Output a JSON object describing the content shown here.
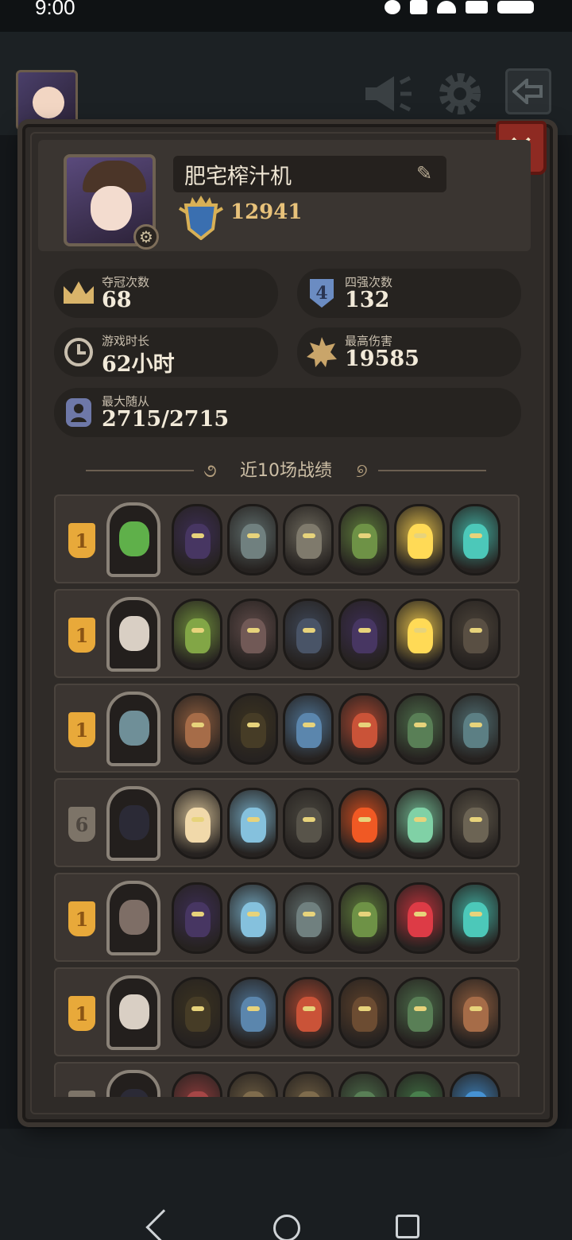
{
  "status_bar": {
    "time": "9:00"
  },
  "profile": {
    "name": "肥宅榨汁机",
    "score": "12941"
  },
  "stats": {
    "champions": {
      "label": "夺冠次数",
      "value": "68"
    },
    "top4": {
      "label": "四强次数",
      "value": "132"
    },
    "playtime": {
      "label": "游戏时长",
      "value": "62小时"
    },
    "max_damage": {
      "label": "最高伤害",
      "value": "19585"
    },
    "max_followers": {
      "label": "最大随从",
      "value": "2715/2715"
    }
  },
  "top4_icon_text": "4",
  "close_glyph": "✕",
  "section": {
    "title": "近10场战绩"
  },
  "matches": [
    {
      "place": "1",
      "hero_color": "#5fb04a",
      "units": [
        "#3b2d52",
        "#5d6b6a",
        "#6a665a",
        "#5c7a3a",
        "#d8b648",
        "#3fa79a"
      ]
    },
    {
      "place": "1",
      "hero_color": "#d9cfc4",
      "units": [
        "#6c8a3a",
        "#5e4a48",
        "#3d4656",
        "#3b2d52",
        "#d8b648",
        "#4a4238"
      ]
    },
    {
      "place": "1",
      "hero_color": "#6f8f98",
      "units": [
        "#8a5a3c",
        "#3a3220",
        "#4c7090",
        "#a8452f",
        "#4a6a48",
        "#4d6a6e"
      ]
    },
    {
      "place": "6",
      "hero_color": "#2b2a36",
      "units": [
        "#c9b58e",
        "#6fa1b8",
        "#49463e",
        "#c84a1e",
        "#6bae8a",
        "#5a5346"
      ]
    },
    {
      "place": "1",
      "hero_color": "#7e6e66",
      "units": [
        "#3b2d52",
        "#6fa1b8",
        "#5d6b6a",
        "#5c7a3a",
        "#b8313a",
        "#3fa79a"
      ]
    },
    {
      "place": "1",
      "hero_color": "#d9cfc4",
      "units": [
        "#3a3220",
        "#4c7090",
        "#a8452f",
        "#5a3f2a",
        "#4a6a48",
        "#8a5a3c"
      ]
    },
    {
      "place": "",
      "hero_color": "#2b2a36",
      "units": [
        "#8a3a3a",
        "#6a5a40",
        "#6a5a40",
        "#4a6a48",
        "#3d6a40",
        "#3a7ab0"
      ]
    }
  ],
  "colors": {
    "gold_badge": "#e8a93a",
    "grey_badge": "#7d7468",
    "score_gold": "#e8c27a",
    "close_red": "#8e2a22"
  }
}
